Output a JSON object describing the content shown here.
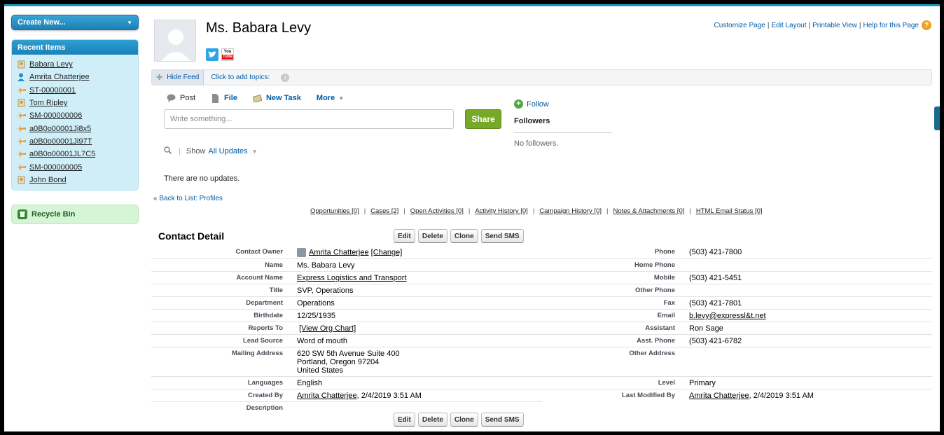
{
  "sidebar": {
    "create_new": "Create New...",
    "recent_header": "Recent Items",
    "recent_items": [
      {
        "label": "Babara Levy",
        "icon": "contact-card-icon"
      },
      {
        "label": "Amrita Chatterjee",
        "icon": "person-icon"
      },
      {
        "label": "ST-00000001",
        "icon": "airplane-icon"
      },
      {
        "label": "Tom Ripley",
        "icon": "contact-card-icon"
      },
      {
        "label": "SM-000000006",
        "icon": "airplane-icon"
      },
      {
        "label": "a0B0o00001Ji8x5",
        "icon": "airplane-icon"
      },
      {
        "label": "a0B0o00001Ji97T",
        "icon": "airplane-icon"
      },
      {
        "label": "a0B0o00001JL7C5",
        "icon": "airplane-icon"
      },
      {
        "label": "SM-000000005",
        "icon": "airplane-icon"
      },
      {
        "label": "John Bond",
        "icon": "contact-card-icon"
      }
    ],
    "recycle_bin": "Recycle Bin"
  },
  "header": {
    "name": "Ms. Babara Levy",
    "links": [
      "Customize Page",
      "Edit Layout",
      "Printable View",
      "Help for this Page"
    ],
    "youtube_top": "You",
    "youtube_bottom": "Tube"
  },
  "feed": {
    "hide_feed": "Hide Feed",
    "topics": "Click to add topics:",
    "info_glyph": "i",
    "tabs": {
      "post": "Post",
      "file": "File",
      "new_task": "New Task",
      "more": "More"
    },
    "placeholder": "Write something...",
    "share": "Share",
    "show": "Show",
    "all_updates": "All Updates",
    "no_updates": "There are no updates.",
    "follow": "Follow",
    "followers": "Followers",
    "no_followers": "No followers."
  },
  "back_link": "« Back to List: Profiles",
  "related_links": [
    "Opportunities [0]",
    "Cases [2]",
    "Open Activities [0]",
    "Activity History [0]",
    "Campaign History [0]",
    "Notes & Attachments [0]",
    "HTML Email Status [0]"
  ],
  "detail": {
    "title": "Contact Detail",
    "buttons": {
      "edit": "Edit",
      "delete": "Delete",
      "clone": "Clone",
      "send_sms": "Send SMS"
    },
    "contact_owner_label": "Contact Owner",
    "contact_owner": "Amrita Chatterjee",
    "change": "[Change]",
    "phone_label": "Phone",
    "phone": "(503) 421-7800",
    "name_label": "Name",
    "name": "Ms. Babara Levy",
    "home_phone_label": "Home Phone",
    "home_phone": "",
    "account_label": "Account Name",
    "account": "Express Logistics and Transport",
    "mobile_label": "Mobile",
    "mobile": "(503) 421-5451",
    "title_label": "Title",
    "title_value": "SVP, Operations",
    "other_phone_label": "Other Phone",
    "other_phone": "",
    "department_label": "Department",
    "department": "Operations",
    "fax_label": "Fax",
    "fax": "(503) 421-7801",
    "birthdate_label": "Birthdate",
    "birthdate": "12/25/1935",
    "email_label": "Email",
    "email": "b.levy@expressl&t.net",
    "reports_to_label": "Reports To",
    "reports_to": "[View Org Chart]",
    "assistant_label": "Assistant",
    "assistant": "Ron Sage",
    "lead_source_label": "Lead Source",
    "lead_source": "Word of mouth",
    "asst_phone_label": "Asst. Phone",
    "asst_phone": "(503) 421-6782",
    "mailing_label": "Mailing Address",
    "mailing_line1": "620 SW 5th Avenue Suite 400",
    "mailing_line2": "Portland, Oregon 97204",
    "mailing_line3": "United States",
    "other_address_label": "Other Address",
    "other_address": "",
    "languages_label": "Languages",
    "languages": "English",
    "level_label": "Level",
    "level": "Primary",
    "created_by_label": "Created By",
    "created_by": "Amrita Chatterjee",
    "created_date": ", 2/4/2019 3:51 AM",
    "modified_by_label": "Last Modified By",
    "modified_by": "Amrita Chatterjee",
    "modified_date": ", 2/4/2019 3:51 AM",
    "description_label": "Description",
    "description": ""
  },
  "colors": {
    "accent": "#1797c0",
    "link": "#015ba7",
    "share": "#78a828"
  }
}
